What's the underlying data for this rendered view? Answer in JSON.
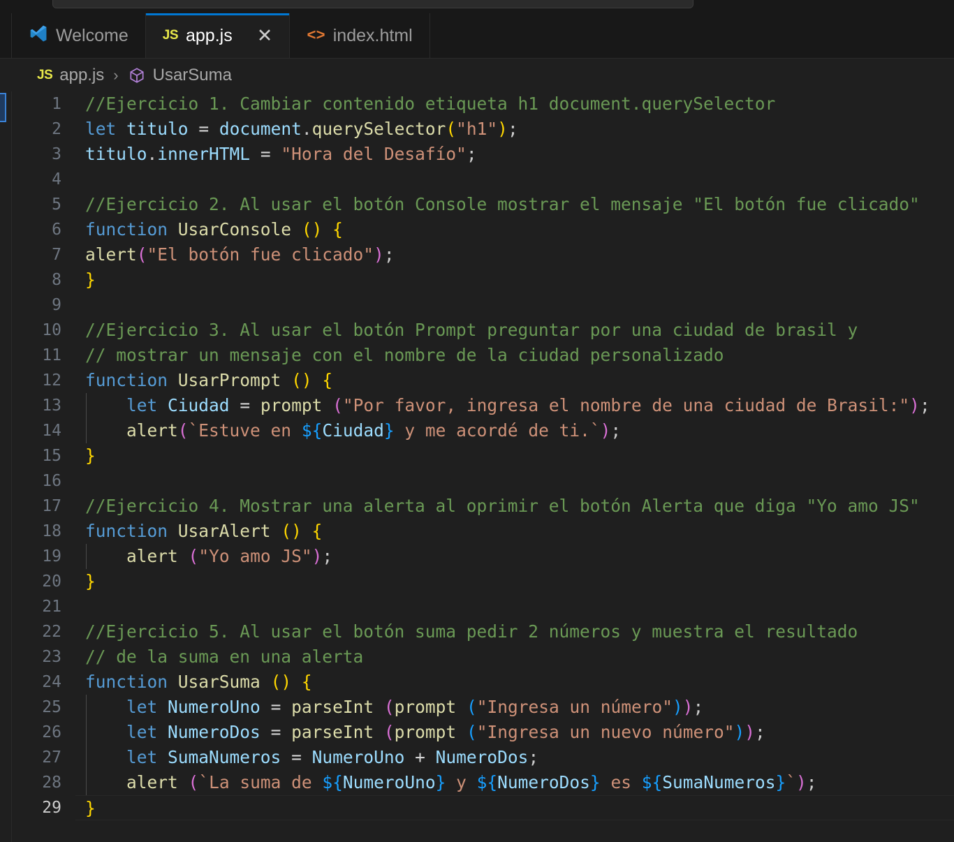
{
  "window": {
    "background": "#1F1F1F",
    "chrome_background": "#181818",
    "accent": "#0078D4"
  },
  "command_center": {
    "value": ""
  },
  "tabs": [
    {
      "label": "Welcome",
      "icon": "vscode-logo-icon",
      "active": false,
      "closable": false
    },
    {
      "label": "app.js",
      "icon": "js-file-icon",
      "active": true,
      "closable": true,
      "close_label": "✕"
    },
    {
      "label": "index.html",
      "icon": "html-file-icon",
      "active": false,
      "closable": false
    }
  ],
  "breadcrumb": {
    "file_icon": "JS",
    "file": "app.js",
    "separator": "›",
    "symbol_icon": "method-symbol-icon",
    "symbol": "UsarSuma"
  },
  "editor": {
    "language": "javascript",
    "active_line": 29,
    "total_lines": 29,
    "colors": {
      "comment": "#6A9955",
      "keyword": "#569CD6",
      "variable": "#9CDCFE",
      "function": "#DCDCAA",
      "string": "#CE9178",
      "plain": "#CCCCCC",
      "bracket_level_1": "#FFD700",
      "bracket_level_2": "#DA70D6",
      "bracket_level_3": "#179FFF",
      "line_number": "#6E7681",
      "line_number_active": "#CCCCCC"
    },
    "lines": [
      {
        "n": 1,
        "indent": 0,
        "text": "//Ejercicio 1. Cambiar contenido etiqueta h1 document.querySelector"
      },
      {
        "n": 2,
        "indent": 0,
        "text": "let titulo = document.querySelector(\"h1\");"
      },
      {
        "n": 3,
        "indent": 0,
        "text": "titulo.innerHTML = \"Hora del Desafío\";"
      },
      {
        "n": 4,
        "indent": 0,
        "text": ""
      },
      {
        "n": 5,
        "indent": 0,
        "text": "//Ejercicio 2. Al usar el botón Console mostrar el mensaje \"El botón fue clicado\""
      },
      {
        "n": 6,
        "indent": 0,
        "text": "function UsarConsole () {"
      },
      {
        "n": 7,
        "indent": 0,
        "text": "alert(\"El botón fue clicado\");"
      },
      {
        "n": 8,
        "indent": 0,
        "text": "}"
      },
      {
        "n": 9,
        "indent": 0,
        "text": ""
      },
      {
        "n": 10,
        "indent": 0,
        "text": "//Ejercicio 3. Al usar el botón Prompt preguntar por una ciudad de brasil y"
      },
      {
        "n": 11,
        "indent": 0,
        "text": "// mostrar un mensaje con el nombre de la ciudad personalizado"
      },
      {
        "n": 12,
        "indent": 0,
        "text": "function UsarPrompt () {"
      },
      {
        "n": 13,
        "indent": 1,
        "text": "    let Ciudad = prompt (\"Por favor, ingresa el nombre de una ciudad de Brasil:\");"
      },
      {
        "n": 14,
        "indent": 1,
        "text": "    alert(`Estuve en ${Ciudad} y me acordé de ti.`);"
      },
      {
        "n": 15,
        "indent": 0,
        "text": "}"
      },
      {
        "n": 16,
        "indent": 0,
        "text": ""
      },
      {
        "n": 17,
        "indent": 0,
        "text": "//Ejercicio 4. Mostrar una alerta al oprimir el botón Alerta que diga \"Yo amo JS\""
      },
      {
        "n": 18,
        "indent": 0,
        "text": "function UsarAlert () {"
      },
      {
        "n": 19,
        "indent": 1,
        "text": "    alert (\"Yo amo JS\");"
      },
      {
        "n": 20,
        "indent": 0,
        "text": "}"
      },
      {
        "n": 21,
        "indent": 0,
        "text": ""
      },
      {
        "n": 22,
        "indent": 0,
        "text": "//Ejercicio 5. Al usar el botón suma pedir 2 números y muestra el resultado"
      },
      {
        "n": 23,
        "indent": 0,
        "text": "// de la suma en una alerta"
      },
      {
        "n": 24,
        "indent": 0,
        "text": "function UsarSuma () {"
      },
      {
        "n": 25,
        "indent": 1,
        "text": "    let NumeroUno = parseInt (prompt (\"Ingresa un número\"));"
      },
      {
        "n": 26,
        "indent": 1,
        "text": "    let NumeroDos = parseInt (prompt (\"Ingresa un nuevo número\"));"
      },
      {
        "n": 27,
        "indent": 1,
        "text": "    let SumaNumeros = NumeroUno + NumeroDos;"
      },
      {
        "n": 28,
        "indent": 1,
        "text": "    alert (`La suma de ${NumeroUno} y ${NumeroDos} es ${SumaNumeros}`);"
      },
      {
        "n": 29,
        "indent": 0,
        "text": "}"
      }
    ],
    "tokens": {
      "1": [
        [
          "cm",
          "//Ejercicio 1. Cambiar contenido etiqueta h1 document.querySelector"
        ]
      ],
      "2": [
        [
          "kw",
          "let"
        ],
        [
          "pl",
          " "
        ],
        [
          "var",
          "titulo"
        ],
        [
          "pl",
          " "
        ],
        [
          "op",
          "="
        ],
        [
          "pl",
          " "
        ],
        [
          "var",
          "document"
        ],
        [
          "pl",
          "."
        ],
        [
          "fn",
          "querySelector"
        ],
        [
          "b1",
          "("
        ],
        [
          "str",
          "\"h1\""
        ],
        [
          "b1",
          ")"
        ],
        [
          "pl",
          ";"
        ]
      ],
      "3": [
        [
          "var",
          "titulo"
        ],
        [
          "pl",
          "."
        ],
        [
          "var",
          "innerHTML"
        ],
        [
          "pl",
          " "
        ],
        [
          "op",
          "="
        ],
        [
          "pl",
          " "
        ],
        [
          "str",
          "\"Hora del Desafío\""
        ],
        [
          "pl",
          ";"
        ]
      ],
      "4": [],
      "5": [
        [
          "cm",
          "//Ejercicio 2. Al usar el botón Console mostrar el mensaje \"El botón fue clicado\""
        ]
      ],
      "6": [
        [
          "kw",
          "function"
        ],
        [
          "pl",
          " "
        ],
        [
          "fn",
          "UsarConsole"
        ],
        [
          "pl",
          " "
        ],
        [
          "b1",
          "()"
        ],
        [
          "pl",
          " "
        ],
        [
          "b1",
          "{"
        ]
      ],
      "7": [
        [
          "fn",
          "alert"
        ],
        [
          "b2",
          "("
        ],
        [
          "str",
          "\"El botón fue clicado\""
        ],
        [
          "b2",
          ")"
        ],
        [
          "pl",
          ";"
        ]
      ],
      "8": [
        [
          "b1",
          "}"
        ]
      ],
      "9": [],
      "10": [
        [
          "cm",
          "//Ejercicio 3. Al usar el botón Prompt preguntar por una ciudad de brasil y"
        ]
      ],
      "11": [
        [
          "cm",
          "// mostrar un mensaje con el nombre de la ciudad personalizado"
        ]
      ],
      "12": [
        [
          "kw",
          "function"
        ],
        [
          "pl",
          " "
        ],
        [
          "fn",
          "UsarPrompt"
        ],
        [
          "pl",
          " "
        ],
        [
          "b1",
          "()"
        ],
        [
          "pl",
          " "
        ],
        [
          "b1",
          "{"
        ]
      ],
      "13": [
        [
          "pl",
          "    "
        ],
        [
          "kw",
          "let"
        ],
        [
          "pl",
          " "
        ],
        [
          "var",
          "Ciudad"
        ],
        [
          "pl",
          " "
        ],
        [
          "op",
          "="
        ],
        [
          "pl",
          " "
        ],
        [
          "fn",
          "prompt"
        ],
        [
          "pl",
          " "
        ],
        [
          "b2",
          "("
        ],
        [
          "str",
          "\"Por favor, ingresa el nombre de una ciudad de Brasil:\""
        ],
        [
          "b2",
          ")"
        ],
        [
          "pl",
          ";"
        ]
      ],
      "14": [
        [
          "pl",
          "    "
        ],
        [
          "fn",
          "alert"
        ],
        [
          "b2",
          "("
        ],
        [
          "str",
          "`Estuve en "
        ],
        [
          "b3",
          "${"
        ],
        [
          "var",
          "Ciudad"
        ],
        [
          "b3",
          "}"
        ],
        [
          "str",
          " y me acordé de ti.`"
        ],
        [
          "b2",
          ")"
        ],
        [
          "pl",
          ";"
        ]
      ],
      "15": [
        [
          "b1",
          "}"
        ]
      ],
      "16": [],
      "17": [
        [
          "cm",
          "//Ejercicio 4. Mostrar una alerta al oprimir el botón Alerta que diga \"Yo amo JS\""
        ]
      ],
      "18": [
        [
          "kw",
          "function"
        ],
        [
          "pl",
          " "
        ],
        [
          "fn",
          "UsarAlert"
        ],
        [
          "pl",
          " "
        ],
        [
          "b1",
          "()"
        ],
        [
          "pl",
          " "
        ],
        [
          "b1",
          "{"
        ]
      ],
      "19": [
        [
          "pl",
          "    "
        ],
        [
          "fn",
          "alert"
        ],
        [
          "pl",
          " "
        ],
        [
          "b2",
          "("
        ],
        [
          "str",
          "\"Yo amo JS\""
        ],
        [
          "b2",
          ")"
        ],
        [
          "pl",
          ";"
        ]
      ],
      "20": [
        [
          "b1",
          "}"
        ]
      ],
      "21": [],
      "22": [
        [
          "cm",
          "//Ejercicio 5. Al usar el botón suma pedir 2 números y muestra el resultado"
        ]
      ],
      "23": [
        [
          "cm",
          "// de la suma en una alerta"
        ]
      ],
      "24": [
        [
          "kw",
          "function"
        ],
        [
          "pl",
          " "
        ],
        [
          "fn",
          "UsarSuma"
        ],
        [
          "pl",
          " "
        ],
        [
          "b1",
          "()"
        ],
        [
          "pl",
          " "
        ],
        [
          "b1",
          "{"
        ]
      ],
      "25": [
        [
          "pl",
          "    "
        ],
        [
          "kw",
          "let"
        ],
        [
          "pl",
          " "
        ],
        [
          "var",
          "NumeroUno"
        ],
        [
          "pl",
          " "
        ],
        [
          "op",
          "="
        ],
        [
          "pl",
          " "
        ],
        [
          "fn",
          "parseInt"
        ],
        [
          "pl",
          " "
        ],
        [
          "b2",
          "("
        ],
        [
          "fn",
          "prompt"
        ],
        [
          "pl",
          " "
        ],
        [
          "b3",
          "("
        ],
        [
          "str",
          "\"Ingresa un número\""
        ],
        [
          "b3",
          ")"
        ],
        [
          "b2",
          ")"
        ],
        [
          "pl",
          ";"
        ]
      ],
      "26": [
        [
          "pl",
          "    "
        ],
        [
          "kw",
          "let"
        ],
        [
          "pl",
          " "
        ],
        [
          "var",
          "NumeroDos"
        ],
        [
          "pl",
          " "
        ],
        [
          "op",
          "="
        ],
        [
          "pl",
          " "
        ],
        [
          "fn",
          "parseInt"
        ],
        [
          "pl",
          " "
        ],
        [
          "b2",
          "("
        ],
        [
          "fn",
          "prompt"
        ],
        [
          "pl",
          " "
        ],
        [
          "b3",
          "("
        ],
        [
          "str",
          "\"Ingresa un nuevo número\""
        ],
        [
          "b3",
          ")"
        ],
        [
          "b2",
          ")"
        ],
        [
          "pl",
          ";"
        ]
      ],
      "27": [
        [
          "pl",
          "    "
        ],
        [
          "kw",
          "let"
        ],
        [
          "pl",
          " "
        ],
        [
          "var",
          "SumaNumeros"
        ],
        [
          "pl",
          " "
        ],
        [
          "op",
          "="
        ],
        [
          "pl",
          " "
        ],
        [
          "var",
          "NumeroUno"
        ],
        [
          "pl",
          " "
        ],
        [
          "op",
          "+"
        ],
        [
          "pl",
          " "
        ],
        [
          "var",
          "NumeroDos"
        ],
        [
          "pl",
          ";"
        ]
      ],
      "28": [
        [
          "pl",
          "    "
        ],
        [
          "fn",
          "alert"
        ],
        [
          "pl",
          " "
        ],
        [
          "b2",
          "("
        ],
        [
          "str",
          "`La suma de "
        ],
        [
          "b3",
          "${"
        ],
        [
          "var",
          "NumeroUno"
        ],
        [
          "b3",
          "}"
        ],
        [
          "str",
          " y "
        ],
        [
          "b3",
          "${"
        ],
        [
          "var",
          "NumeroDos"
        ],
        [
          "b3",
          "}"
        ],
        [
          "str",
          " es "
        ],
        [
          "b3",
          "${"
        ],
        [
          "var",
          "SumaNumeros"
        ],
        [
          "b3",
          "}"
        ],
        [
          "str",
          "`"
        ],
        [
          "b2",
          ")"
        ],
        [
          "pl",
          ";"
        ]
      ],
      "29": [
        [
          "b1",
          "}"
        ]
      ]
    }
  }
}
